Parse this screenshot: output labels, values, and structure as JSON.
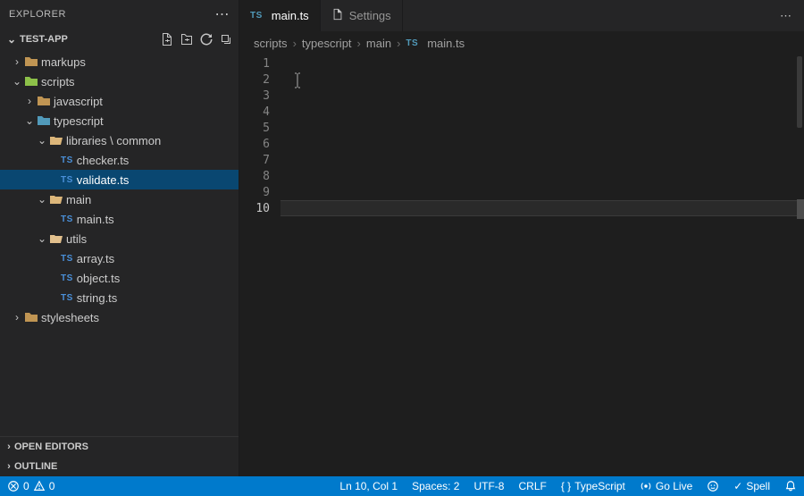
{
  "explorer": {
    "title": "EXPLORER",
    "project": "TEST-APP",
    "open_editors": "OPEN EDITORS",
    "outline": "OUTLINE"
  },
  "tree": {
    "markups": "markups",
    "scripts": "scripts",
    "javascript": "javascript",
    "typescript": "typescript",
    "libraries": "libraries \\ common",
    "checker": "checker.ts",
    "validate": "validate.ts",
    "main": "main",
    "main_ts": "main.ts",
    "utils": "utils",
    "array": "array.ts",
    "object": "object.ts",
    "string": "string.ts",
    "stylesheets": "stylesheets"
  },
  "tabs": {
    "main": "main.ts",
    "settings": "Settings"
  },
  "breadcrumbs": {
    "scripts": "scripts",
    "typescript": "typescript",
    "main": "main",
    "file": "main.ts"
  },
  "editor": {
    "lines": [
      "1",
      "2",
      "3",
      "4",
      "5",
      "6",
      "7",
      "8",
      "9",
      "10"
    ],
    "current_line_index": 9
  },
  "status": {
    "errors": "0",
    "warnings": "0",
    "ln_col": "Ln 10, Col 1",
    "spaces": "Spaces: 2",
    "encoding": "UTF-8",
    "eol": "CRLF",
    "lang": "TypeScript",
    "golive": "Go Live",
    "spell": "Spell"
  },
  "ts_badge": "TS"
}
